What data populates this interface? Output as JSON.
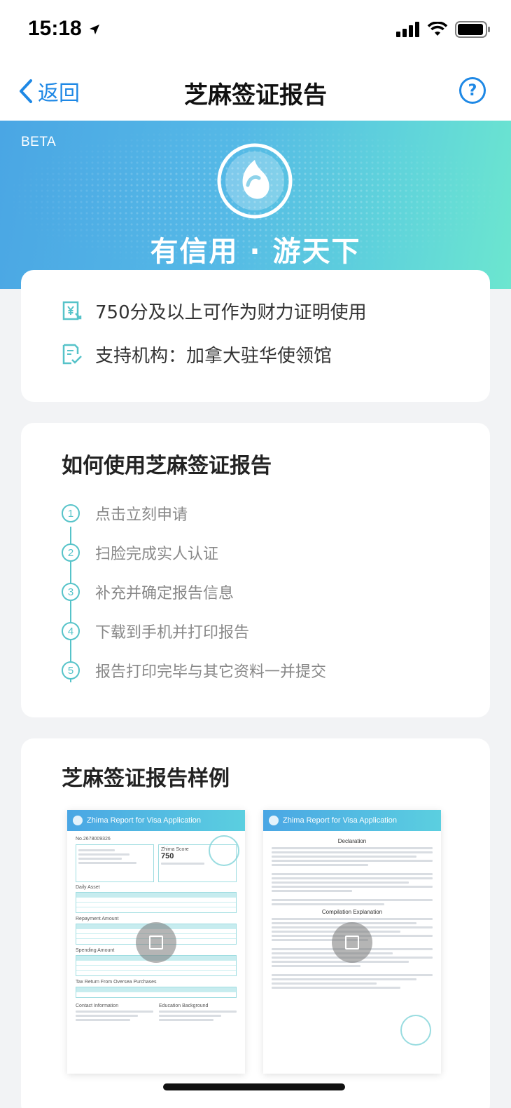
{
  "status_bar": {
    "time": "15:18"
  },
  "nav": {
    "back_label": "返回",
    "title": "芝麻签证报告",
    "help_label": "?"
  },
  "banner": {
    "beta": "BETA",
    "slogan": "有信用 · 游天下"
  },
  "info": {
    "items": [
      {
        "icon": "yuan-document-icon",
        "text": "750分及以上可作为财力证明使用"
      },
      {
        "icon": "document-check-icon",
        "text": "支持机构：加拿大驻华使领馆"
      }
    ]
  },
  "how_to": {
    "title": "如何使用芝麻签证报告",
    "steps": [
      {
        "num": "1",
        "text": "点击立刻申请"
      },
      {
        "num": "2",
        "text": "扫脸完成实人认证"
      },
      {
        "num": "3",
        "text": "补充并确定报告信息"
      },
      {
        "num": "4",
        "text": "下载到手机并打印报告"
      },
      {
        "num": "5",
        "text": "报告打印完毕与其它资料一并提交"
      }
    ]
  },
  "sample": {
    "title": "芝麻签证报告样例",
    "doc1": {
      "header": "Zhima Report for Visa Application",
      "number": "No.2678009326",
      "score_label": "Zhima Score",
      "score": "750",
      "sections": [
        "Daily Asset",
        "Repayment Amount",
        "Spending Amount",
        "Tax Return From Oversea Purchases",
        "Contact Information",
        "Education Background"
      ]
    },
    "doc2": {
      "header": "Zhima Report for Visa Application",
      "sections": [
        "Declaration",
        "Compilation Explanation"
      ]
    }
  },
  "colors": {
    "accent": "#1e88e5",
    "teal": "#56c3c9",
    "banner_start": "#4aa6e4",
    "banner_end": "#6ce6cf"
  }
}
